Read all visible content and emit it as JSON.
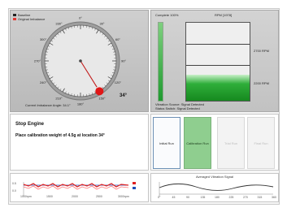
{
  "gauge": {
    "legend": [
      {
        "label": "Baseline",
        "color": "#222222"
      },
      {
        "label": "Original Imbalance",
        "color": "#e53935"
      }
    ],
    "dial_labels": [
      "0°",
      "30°",
      "60°",
      "90°",
      "120°",
      "150°",
      "180°",
      "210°",
      "240°",
      "270°",
      "300°",
      "330°"
    ],
    "current_angle_text": "Current Imbalance Angle: 34.1°",
    "display_value": "34°",
    "needle_angle_deg": 148,
    "marker_color": "#e01616"
  },
  "bars": {
    "complete_label": "Complete 100%",
    "complete_pct": 100,
    "rpm_label": "RPM [1978]",
    "rpm_ticks": [
      "2700 RPM",
      "2200 RPM"
    ],
    "rpm_fraction": 0.33,
    "vibration_source_text": [
      "Vibration Source: Signal Detected",
      "Status Switch: Signal Detected"
    ]
  },
  "instructions": {
    "title": "Stop Engine",
    "detail": "Place calibration weight of 4.5g at location 34°"
  },
  "steps": [
    {
      "label": "Initial Run",
      "state": "done"
    },
    {
      "label": "Calibration Run",
      "state": "active"
    },
    {
      "label": "Trial Run",
      "state": "pending"
    },
    {
      "label": "Final Run",
      "state": "pending"
    }
  ],
  "bottom_left": {
    "ticks": [
      "1000rpm",
      "1500",
      "2000",
      "2500",
      "3000rpm"
    ],
    "y_ticks": [
      "0.5",
      "0.0"
    ]
  },
  "bottom_right": {
    "title": "Averaged Vibration Signal",
    "ticks": [
      "0°",
      "45",
      "90",
      "135",
      "180",
      "225",
      "270",
      "315",
      "360"
    ]
  }
}
